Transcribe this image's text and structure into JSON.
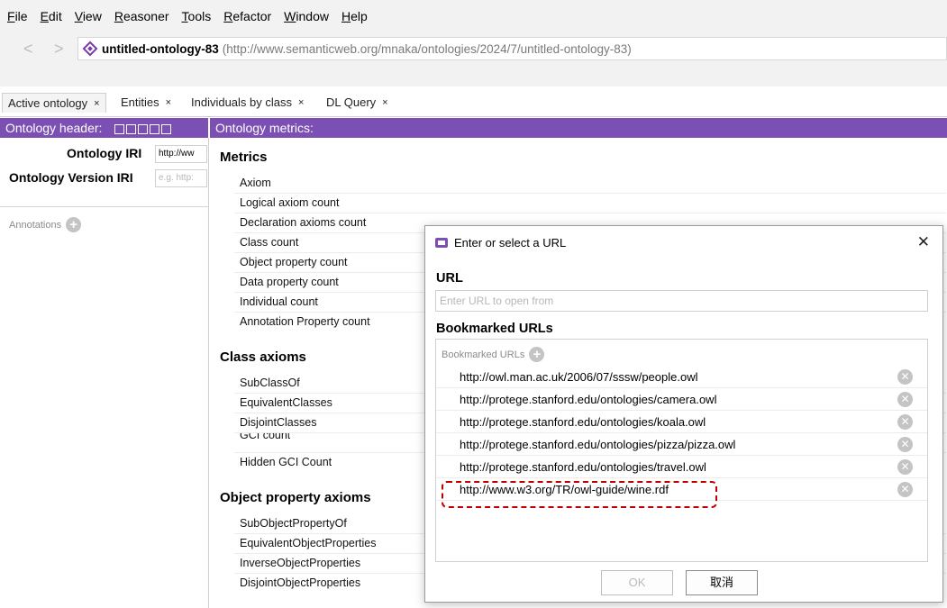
{
  "menu": {
    "items": [
      {
        "ul": "F",
        "rest": "ile"
      },
      {
        "ul": "E",
        "rest": "dit"
      },
      {
        "ul": "V",
        "rest": "iew"
      },
      {
        "ul": "R",
        "rest": "easoner"
      },
      {
        "ul": "T",
        "rest": "ools"
      },
      {
        "ul": "R",
        "rest": "efactor"
      },
      {
        "ul": "W",
        "rest": "indow"
      },
      {
        "ul": "H",
        "rest": "elp"
      }
    ]
  },
  "address": {
    "name": "untitled-ontology-83",
    "iri": "(http://www.semanticweb.org/mnaka/ontologies/2024/7/untitled-ontology-83)"
  },
  "tabs": [
    "Active ontology",
    "Entities",
    "Individuals by class",
    "DL Query"
  ],
  "tab_close": "×",
  "left": {
    "header": "Ontology header:",
    "iri_label": "Ontology IRI",
    "iri_value": "http://ww",
    "version_label": "Ontology Version IRI",
    "version_placeholder": "e.g. http:",
    "annotations": "Annotations"
  },
  "metrics": {
    "header": "Ontology metrics:",
    "sections": {
      "metrics": {
        "title": "Metrics",
        "rows": [
          "Axiom",
          "Logical axiom count",
          "Declaration axioms count",
          "Class count",
          "Object property count",
          "Data property count",
          "Individual count",
          "Annotation Property count"
        ]
      },
      "class": {
        "title": "Class axioms",
        "rows": [
          "SubClassOf",
          "EquivalentClasses",
          "DisjointClasses",
          "GCI count",
          "Hidden GCI Count"
        ]
      },
      "objprop": {
        "title": "Object property axioms",
        "rows": [
          "SubObjectPropertyOf",
          "EquivalentObjectProperties",
          "InverseObjectProperties",
          "DisjointObjectProperties"
        ]
      }
    }
  },
  "dialog": {
    "title": "Enter or select a URL",
    "url_label": "URL",
    "url_placeholder": "Enter URL to open from",
    "bookmarked_label": "Bookmarked URLs",
    "bookmarked_panel_label": "Bookmarked URLs",
    "bookmarks": [
      "http://owl.man.ac.uk/2006/07/sssw/people.owl",
      "http://protege.stanford.edu/ontologies/camera.owl",
      "http://protege.stanford.edu/ontologies/koala.owl",
      "http://protege.stanford.edu/ontologies/pizza/pizza.owl",
      "http://protege.stanford.edu/ontologies/travel.owl",
      "http://www.w3.org/TR/owl-guide/wine.rdf"
    ],
    "ok": "OK",
    "cancel": "取消"
  }
}
